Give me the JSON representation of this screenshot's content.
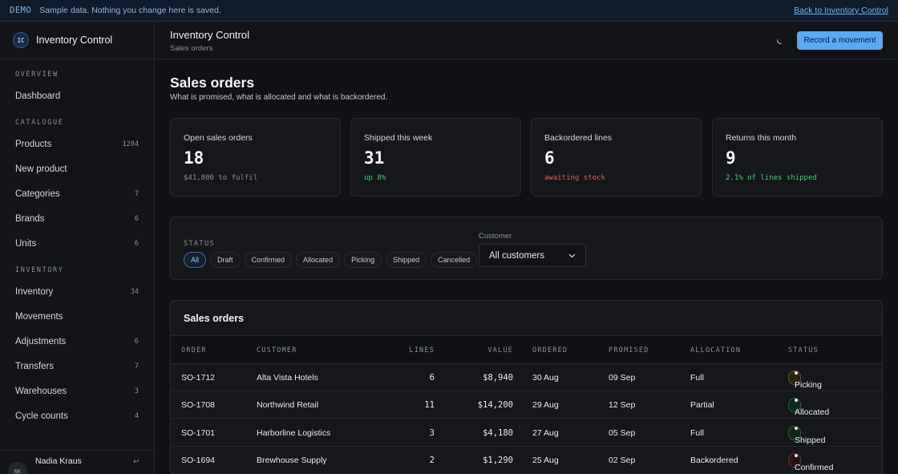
{
  "banner": {
    "tag": "DEMO",
    "message": "Sample data. Nothing you change here is saved.",
    "back_link": "Back to Inventory Control"
  },
  "brand": {
    "initials": "IC",
    "name": "Inventory Control"
  },
  "sidebar": {
    "overview_label": "OVERVIEW",
    "overview_items": [
      {
        "label": "Dashboard",
        "count": ""
      }
    ],
    "catalogue_label": "CATALOGUE",
    "catalogue_items": [
      {
        "label": "Products",
        "count": "1284"
      },
      {
        "label": "New product",
        "count": ""
      },
      {
        "label": "Categories",
        "count": "7"
      },
      {
        "label": "Brands",
        "count": "6"
      },
      {
        "label": "Units",
        "count": "6"
      }
    ],
    "inventory_label": "INVENTORY",
    "inventory_items": [
      {
        "label": "Inventory",
        "count": "34"
      },
      {
        "label": "Movements",
        "count": ""
      },
      {
        "label": "Adjustments",
        "count": "6"
      },
      {
        "label": "Transfers",
        "count": "7"
      },
      {
        "label": "Warehouses",
        "count": "3"
      },
      {
        "label": "Cycle counts",
        "count": "4"
      }
    ]
  },
  "user": {
    "initials": "NK",
    "name": "Nadia Kraus",
    "more": "↩"
  },
  "header": {
    "title": "Inventory Control",
    "breadcrumb": "Sales orders",
    "theme_icon": "moon-icon",
    "primary_button": "Record a movement"
  },
  "page": {
    "title": "Sales orders",
    "subtitle": "What is promised, what is allocated and what is backordered."
  },
  "stats": [
    {
      "label": "Open sales orders",
      "value": "18",
      "note": "$41,800 to fulfil",
      "note_color": "#8b9096"
    },
    {
      "label": "Shipped this week",
      "value": "31",
      "note": "up 8%",
      "note_color": "#3ecf7a"
    },
    {
      "label": "Backordered lines",
      "value": "6",
      "note": "awaiting stock",
      "note_color": "#f05a5a"
    },
    {
      "label": "Returns this month",
      "value": "9",
      "note": "2.1% of lines shipped",
      "note_color": "#3ecf7a"
    }
  ],
  "filters": {
    "status_label": "STATUS",
    "statuses": [
      "All",
      "Draft",
      "Confirmed",
      "Allocated",
      "Picking",
      "Shipped",
      "Cancelled"
    ],
    "active_status": "All",
    "customer_label": "Customer",
    "customer_value": "All customers"
  },
  "table": {
    "title": "Sales orders",
    "columns": [
      "ORDER",
      "CUSTOMER",
      "LINES",
      "VALUE",
      "ORDERED",
      "PROMISED",
      "ALLOCATION",
      "STATUS"
    ],
    "rows": [
      {
        "order": "SO-1712",
        "customer": "Alta Vista Hotels",
        "lines": "6",
        "value": "$8,940",
        "ordered": "30 Aug",
        "promised": "09 Sep",
        "allocation": "Full",
        "status": "Picking",
        "status_color": "#e0a83a",
        "status_bg": "#2a2212"
      },
      {
        "order": "SO-1708",
        "customer": "Northwind Retail",
        "lines": "11",
        "value": "$14,200",
        "ordered": "29 Aug",
        "promised": "12 Sep",
        "allocation": "Partial",
        "status": "Allocated",
        "status_color": "#3ecf7a",
        "status_bg": "#11261a"
      },
      {
        "order": "SO-1701",
        "customer": "Harborline Logistics",
        "lines": "3",
        "value": "$4,180",
        "ordered": "27 Aug",
        "promised": "05 Sep",
        "allocation": "Full",
        "status": "Shipped",
        "status_color": "#3ecf7a",
        "status_bg": "#11261a"
      },
      {
        "order": "SO-1694",
        "customer": "Brewhouse Supply",
        "lines": "2",
        "value": "$1,290",
        "ordered": "25 Aug",
        "promised": "02 Sep",
        "allocation": "Backordered",
        "status": "Confirmed",
        "status_color": "#f05a5a",
        "status_bg": "#2a1416"
      }
    ]
  }
}
